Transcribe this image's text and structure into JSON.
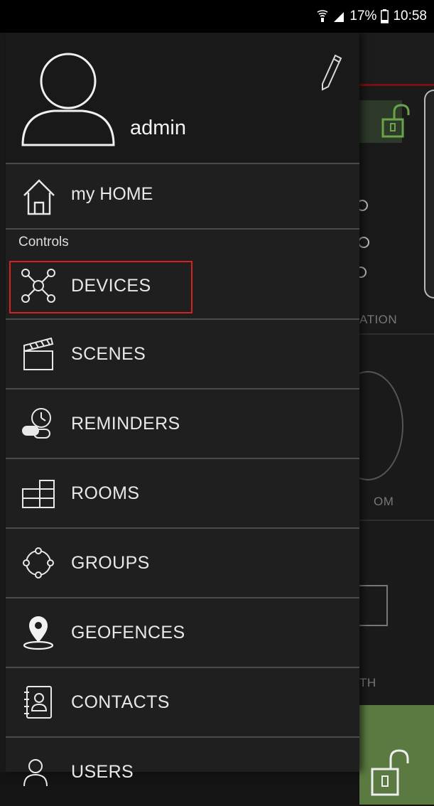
{
  "status_bar": {
    "battery": "17%",
    "time": "10:58",
    "icons": [
      "wifi-calling-icon",
      "signal-icon",
      "battery-icon"
    ]
  },
  "drawer": {
    "username": "admin",
    "home_label": "my HOME",
    "section_label": "Controls",
    "items": [
      {
        "label": "DEVICES",
        "icon": "devices-icon",
        "highlighted": true
      },
      {
        "label": "SCENES",
        "icon": "clapperboard-icon"
      },
      {
        "label": "REMINDERS",
        "icon": "reminders-icon"
      },
      {
        "label": "ROOMS",
        "icon": "rooms-icon"
      },
      {
        "label": "GROUPS",
        "icon": "groups-icon"
      },
      {
        "label": "GEOFENCES",
        "icon": "location-pin-icon"
      },
      {
        "label": "CONTACTS",
        "icon": "contacts-icon"
      },
      {
        "label": "USERS",
        "icon": "users-icon"
      }
    ]
  },
  "background": {
    "text_1": "ATION",
    "text_2": "OM",
    "text_3": "TH"
  },
  "colors": {
    "drawer_bg": "#1f1f1f",
    "highlight": "#d62222",
    "accent_green": "#5b7a41",
    "accent_red": "#7a1010"
  }
}
